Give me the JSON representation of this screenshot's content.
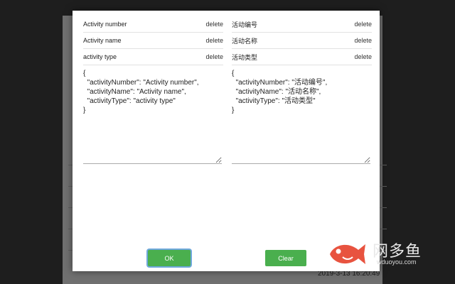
{
  "modal": {
    "left_fields": [
      {
        "label": "Activity number",
        "delete": "delete"
      },
      {
        "label": "Activity name",
        "delete": "delete"
      },
      {
        "label": "activity type",
        "delete": "delete"
      }
    ],
    "right_fields": [
      {
        "label": "活动编号",
        "delete": "delete"
      },
      {
        "label": "活动名称",
        "delete": "delete"
      },
      {
        "label": "活动类型",
        "delete": "delete"
      }
    ],
    "left_json": "{\n  \"activityNumber\": \"Activity number\",\n  \"activityName\": \"Activity name\",\n  \"activityType\": \"activity type\"\n}",
    "right_json": "{\n  \"activityNumber\": \"活动编号\",\n  \"activityName\": \"活动名称\",\n  \"activityType\": \"活动类型\"\n}",
    "ok_label": "OK",
    "clear_label": "Clear"
  },
  "background": {
    "timestamp": "2019-3-13 16:20:49"
  },
  "watermark": {
    "cn": "网多鱼",
    "en": "wduoyou.com"
  },
  "colors": {
    "button_green": "#4aaf4e",
    "focus_ring": "#6fa8dc",
    "watermark_fish": "#e8533f"
  }
}
